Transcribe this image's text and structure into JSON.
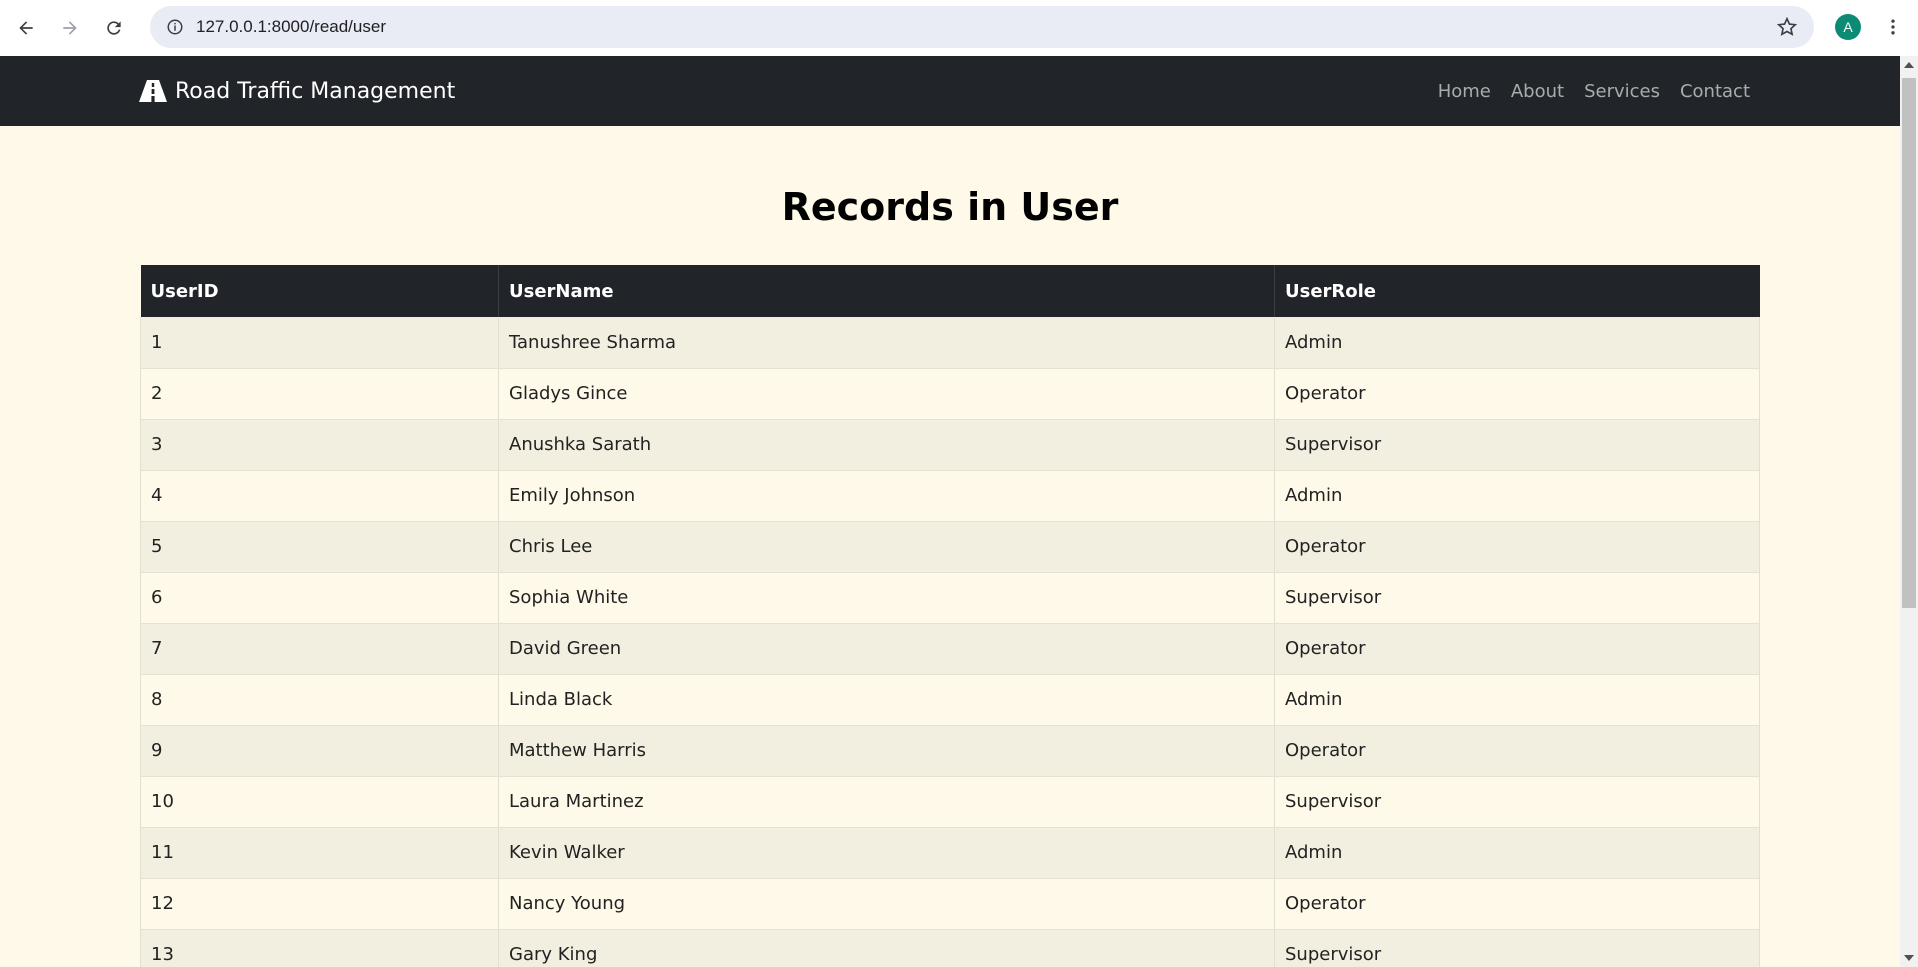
{
  "browser": {
    "url": "127.0.0.1:8000/read/user",
    "profile_initial": "A"
  },
  "navbar": {
    "brand": "Road Traffic Management",
    "links": [
      "Home",
      "About",
      "Services",
      "Contact"
    ]
  },
  "page": {
    "title": "Records in User"
  },
  "table": {
    "headers": [
      "UserID",
      "UserName",
      "UserRole"
    ],
    "rows": [
      [
        "1",
        "Tanushree Sharma",
        "Admin"
      ],
      [
        "2",
        "Gladys Gince",
        "Operator"
      ],
      [
        "3",
        "Anushka Sarath",
        "Supervisor"
      ],
      [
        "4",
        "Emily Johnson",
        "Admin"
      ],
      [
        "5",
        "Chris Lee",
        "Operator"
      ],
      [
        "6",
        "Sophia White",
        "Supervisor"
      ],
      [
        "7",
        "David Green",
        "Operator"
      ],
      [
        "8",
        "Linda Black",
        "Admin"
      ],
      [
        "9",
        "Matthew Harris",
        "Operator"
      ],
      [
        "10",
        "Laura Martinez",
        "Supervisor"
      ],
      [
        "11",
        "Kevin Walker",
        "Admin"
      ],
      [
        "12",
        "Nancy Young",
        "Operator"
      ],
      [
        "13",
        "Gary King",
        "Supervisor"
      ]
    ]
  }
}
